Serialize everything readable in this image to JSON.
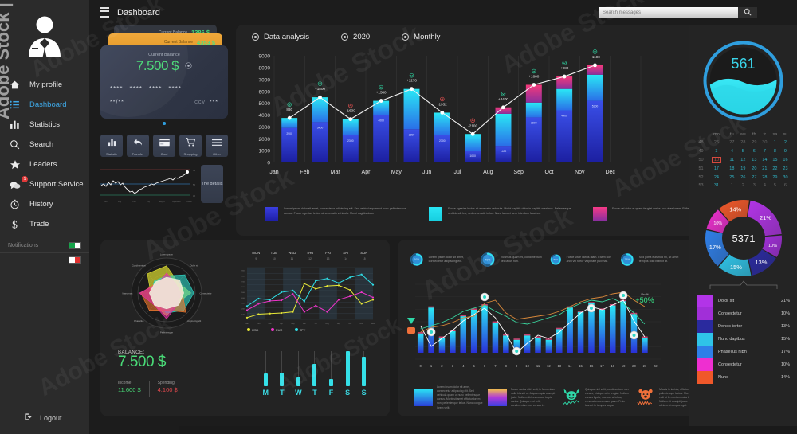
{
  "sidebar": {
    "avatar_name": "user-avatar",
    "items": [
      {
        "label": "My profile",
        "icon": "home-icon",
        "active": false
      },
      {
        "label": "Dashboard",
        "icon": "list-icon",
        "active": true
      },
      {
        "label": "Statistics",
        "icon": "bar-chart-icon",
        "active": false
      },
      {
        "label": "Search",
        "icon": "search-icon",
        "active": false
      },
      {
        "label": "Leaders",
        "icon": "star-icon",
        "active": false
      },
      {
        "label": "Support Service",
        "icon": "chat-icon",
        "active": false,
        "badge": "1"
      },
      {
        "label": "History",
        "icon": "clock-icon",
        "active": false
      },
      {
        "label": "Trade",
        "icon": "dollar-icon",
        "active": false
      }
    ],
    "notifications_label": "Notifications",
    "logout_label": "Logout",
    "logout_icon": "logout-icon"
  },
  "header": {
    "menu_icon": "hamburger-icon",
    "title": "Dashboard",
    "search_placeholder": "Search messages",
    "search_value": "",
    "search_icon": "search-icon"
  },
  "cards": {
    "mini1": {
      "label": "Current Balance",
      "value": "1386 $"
    },
    "mini2": {
      "label": "Current Balance",
      "value": "4353 $"
    },
    "main": {
      "label": "Current Balance",
      "amount": "7.500 $",
      "number": [
        "****",
        "****",
        "****",
        "****"
      ],
      "expiry": "**/**",
      "cvv_label": "CCV",
      "cvv": "***",
      "toggle_icon": "eye-icon"
    }
  },
  "quick_actions": [
    {
      "label": "Statistic",
      "icon": "bar-chart-icon"
    },
    {
      "label": "Transfer",
      "icon": "arrow-back-icon"
    },
    {
      "label": "Card",
      "icon": "credit-card-icon"
    },
    {
      "label": "Shopping",
      "icon": "cart-icon"
    },
    {
      "label": "Other",
      "icon": "menu-icon"
    }
  ],
  "details_button": "The details",
  "mini_line": {
    "months": [
      "March",
      "May",
      "June",
      "July",
      "August",
      "September",
      "October"
    ],
    "levels": [
      "71",
      "55",
      "36"
    ]
  },
  "analysis": {
    "tabs": [
      {
        "label": "Data analysis",
        "icon": "circle-dot-icon"
      },
      {
        "label": "2020",
        "icon": "circle-dot-icon"
      },
      {
        "label": "Monthly",
        "icon": "circle-dot-icon"
      }
    ],
    "legend": [
      {
        "color": "#2a2fd0",
        "text": "Lorem ipsum dolor sit amet, consectetur adipiscing elit. Sed vehicula quam ut nunc pellentesque cursus. Fusce egestas lectus at venenatis vehicula. Morbi sagittis dolor"
      },
      {
        "color": "#22e8f0",
        "text": "Fusce egestas lectus at venenatis vehicula. Morbi sagittis dolor in sagittis maximus. Pellentesque sed blandit leo, sed venenatis tellus. Nunc laoreet sem interdum faucibus"
      },
      {
        "color": "#ef2f86",
        "text": "Fusce vel dolor et quam feugiat varius non vitae lorem. Pellentesque sit amet hendrerit arcu."
      }
    ]
  },
  "chart_data": [
    {
      "type": "bar",
      "name": "main-data-analysis",
      "title": "Data analysis",
      "categories": [
        "Jan",
        "Feb",
        "Mar",
        "Apr",
        "May",
        "Jun",
        "Jul",
        "Aug",
        "Sep",
        "Oct",
        "Nov",
        "Dec"
      ],
      "ylim": [
        0,
        9000
      ],
      "yticks": [
        0,
        1000,
        2000,
        3000,
        4000,
        5000,
        6000,
        7000,
        8000,
        9000
      ],
      "series": [
        {
          "name": "base-blue",
          "values": [
            2900,
            3400,
            2300,
            4000,
            2800,
            2300,
            1000,
            1400,
            3800,
            4400,
            5200,
            0
          ]
        },
        {
          "name": "cyan-top",
          "values": [
            3750,
            5500,
            3650,
            5200,
            6200,
            4200,
            2400,
            4100,
            5050,
            6200,
            7400,
            0
          ]
        },
        {
          "name": "pink-top",
          "values": [
            0,
            0,
            0,
            0,
            0,
            0,
            0,
            4650,
            6550,
            7250,
            8200,
            0
          ]
        }
      ],
      "bar_inner_labels": [
        "2900",
        "3400",
        "2300",
        "4000",
        "2800",
        "2300",
        "1000",
        "1400",
        "3800",
        "4400",
        "5200",
        ""
      ],
      "delta_labels": [
        "860",
        "+1500",
        "-1630",
        "+1580",
        "+1270",
        "-1932",
        "-2100",
        "+2400",
        "+1860",
        "+980",
        "+1100",
        ""
      ],
      "delta_positive": [
        true,
        true,
        false,
        true,
        true,
        false,
        false,
        true,
        true,
        true,
        true,
        true
      ],
      "line_values": [
        3750,
        5500,
        3650,
        5200,
        6200,
        4200,
        2400,
        4650,
        6550,
        7250,
        8200,
        0
      ]
    },
    {
      "type": "radar",
      "name": "radar-chart",
      "axes": [
        "Lorem ipsum",
        "Dolor sit",
        "Consectetur",
        "Adipiscing elit",
        "Pellentesque",
        "Phasellus",
        "Maecenas",
        "Condimentum"
      ]
    },
    {
      "type": "line",
      "name": "weekly-currency-chart",
      "day_labels": [
        {
          "day": "MON",
          "num": "9"
        },
        {
          "day": "TUE",
          "num": "10"
        },
        {
          "day": "WED",
          "num": "11"
        },
        {
          "day": "THU",
          "num": "12"
        },
        {
          "day": "FRI",
          "num": "13"
        },
        {
          "day": "SAT",
          "num": "14"
        },
        {
          "day": "SUN",
          "num": "15"
        }
      ],
      "legend": [
        {
          "name": "USD",
          "color": "#e8e836"
        },
        {
          "name": "EUR",
          "color": "#ee34c9"
        },
        {
          "name": "JPY",
          "color": "#2fdfe8"
        }
      ],
      "x_ticks": [
        "Jan",
        "Feb",
        "Mar",
        "Apr",
        "May",
        "Jun",
        "Jul",
        "Aug",
        "Sep",
        "Oct",
        "Nov",
        "Dec"
      ],
      "y_ticks": [
        "1000",
        "2000",
        "3000",
        "4000",
        "5000",
        "6000",
        "7000",
        "8000",
        "9000"
      ],
      "series": [
        {
          "name": "USD",
          "color": "#e8e836",
          "values": [
            300,
            900,
            1000,
            1100,
            1300,
            6200,
            5300,
            5800,
            5900,
            5100,
            2700,
            3400
          ]
        },
        {
          "name": "EUR",
          "color": "#ee34c9",
          "values": [
            1600,
            2700,
            3200,
            3300,
            4400,
            1300,
            2400,
            1300,
            3400,
            4000,
            4700,
            3800
          ]
        },
        {
          "name": "JPY",
          "color": "#2fdfe8",
          "values": [
            2300,
            3600,
            3400,
            4700,
            5000,
            3100,
            6700,
            7100,
            6300,
            7300,
            7800,
            6000
          ]
        }
      ]
    },
    {
      "type": "bar",
      "name": "main-trading-chart",
      "x_ticks": [
        "0",
        "1",
        "2",
        "3",
        "4",
        "5",
        "6",
        "7",
        "8",
        "9",
        "10",
        "11",
        "12",
        "13",
        "14",
        "15",
        "16",
        "17",
        "18",
        "19",
        "20",
        "21",
        "22"
      ],
      "profit_label": "Profit",
      "profit_value": "+50%",
      "values": [
        18,
        42,
        14,
        20,
        34,
        40,
        44,
        28,
        16,
        12,
        16,
        14,
        12,
        22,
        42,
        38,
        46,
        40,
        44,
        48,
        36,
        14,
        0
      ]
    },
    {
      "type": "bar",
      "name": "weekly-spending-bars",
      "categories": [
        "M",
        "T",
        "W",
        "T",
        "F",
        "S",
        "S"
      ],
      "values": [
        26,
        28,
        18,
        46,
        14,
        72,
        60
      ]
    },
    {
      "type": "pie",
      "name": "donut-distribution",
      "center_value": "5371",
      "slices": [
        {
          "label": "Dolor sit",
          "value": 21,
          "display": "21%",
          "color": "#b234e8"
        },
        {
          "label": "Consectetur",
          "value": 10,
          "display": "10%",
          "color": "#a12fd8"
        },
        {
          "label": "Donec tortor",
          "value": 13,
          "display": "13%",
          "color": "#2a2a9e"
        },
        {
          "label": "Nunc dapibus",
          "value": 15,
          "display": "15%",
          "color": "#2fc4e8"
        },
        {
          "label": "Phasellus nibh",
          "value": 17,
          "display": "17%",
          "color": "#2f7fe8"
        },
        {
          "label": "Consectetur",
          "value": 10,
          "display": "10%",
          "color": "#ee2fd0"
        },
        {
          "label": "Nunc",
          "value": 14,
          "display": "14%",
          "color": "#f0582a"
        }
      ]
    }
  ],
  "gauge": {
    "value": "561",
    "accent": "#2fd8e8"
  },
  "calendar": {
    "weekday_headers": [
      "mo",
      "tu",
      "we",
      "th",
      "fr",
      "sa",
      "su"
    ],
    "rows": [
      {
        "week": "48",
        "days": [
          "26",
          "27",
          "28",
          "29",
          "30",
          "1",
          "2"
        ],
        "muted": [
          true,
          true,
          true,
          true,
          true,
          false,
          false
        ]
      },
      {
        "week": "49",
        "days": [
          "3",
          "4",
          "5",
          "6",
          "7",
          "8",
          "9"
        ],
        "muted": [
          false,
          false,
          false,
          false,
          false,
          false,
          false
        ]
      },
      {
        "week": "50",
        "days": [
          "10",
          "11",
          "12",
          "13",
          "14",
          "15",
          "16"
        ],
        "muted": [
          false,
          false,
          false,
          false,
          false,
          false,
          false
        ],
        "today": 0
      },
      {
        "week": "51",
        "days": [
          "17",
          "18",
          "19",
          "20",
          "21",
          "22",
          "23"
        ],
        "muted": [
          false,
          false,
          false,
          false,
          false,
          false,
          false
        ]
      },
      {
        "week": "52",
        "days": [
          "24",
          "25",
          "26",
          "27",
          "28",
          "29",
          "30"
        ],
        "muted": [
          false,
          false,
          false,
          false,
          false,
          false,
          false
        ]
      },
      {
        "week": "53",
        "days": [
          "31",
          "1",
          "2",
          "3",
          "4",
          "5",
          "6"
        ],
        "muted": [
          false,
          true,
          true,
          true,
          true,
          true,
          true
        ]
      }
    ]
  },
  "balance_panel": {
    "label": "BALANCE:",
    "amount": "7.500 $",
    "income_label": "Income",
    "income_value": "11.600 $",
    "spending_label": "Spending",
    "spending_value": "4.100 $"
  },
  "rings": [
    {
      "pct": "60%",
      "value": 60,
      "text": "Lorem ipsum dolor sit amet, consectetur adipiscing elit."
    },
    {
      "pct": "40%",
      "value": 40,
      "text": "Vivamus quam mi, condimentum nec lacus non."
    },
    {
      "pct": "80%",
      "value": 80,
      "text": "Fusce vitae varius diam. Etiam non arcu vel tortor vulputate pulvinar."
    },
    {
      "pct": "75%",
      "value": 75,
      "text": "Sed porta euismod mi, sit amet tempus odio blandit at."
    }
  ],
  "bottom_cards": [
    {
      "icon": "gradient-swatch",
      "text": "Lorem ipsum dolor sit amet, consectetur adipiscing elit. Sed vehicula quam ut nunc pellentesque cursus. Morbi sit amet efficitur lorem non, pellentesque tellus. Nunc congue lorem velit."
    },
    {
      "icon": "gradient-swatch",
      "text": "Fusce varius nibh velit, in fermentum nulla blandit ut. Aliquam quis suscipit justo. Nullam ultrices cursus turpis varius. Quisque nisi velit, condimentum non cursus in."
    },
    {
      "icon": "bull-icon",
      "text": "Quisque nisl velit, condimentum non cursus, tristique at in feugiat. Nullam cursus ligula, rhoncus at tellus, venenatis accumsan quam. Proin laoreet in tempus augue."
    },
    {
      "icon": "bear-icon",
      "text": "Mauris in lacinia, efficitur lorem non, pellentesque lectus. Morbi sit amet velit ut fermentum nulla blandit ut. Nullam sit suscipit justo. Nullam ultrices ut congue eget."
    }
  ],
  "accents": {
    "cyan": "#2fd8e8",
    "green": "#49da77",
    "blue": "#3fa9e8",
    "red": "#e0484d",
    "panel": "#232323",
    "sidebar": "#2b2b2b",
    "bg": "#1c1c1c"
  }
}
